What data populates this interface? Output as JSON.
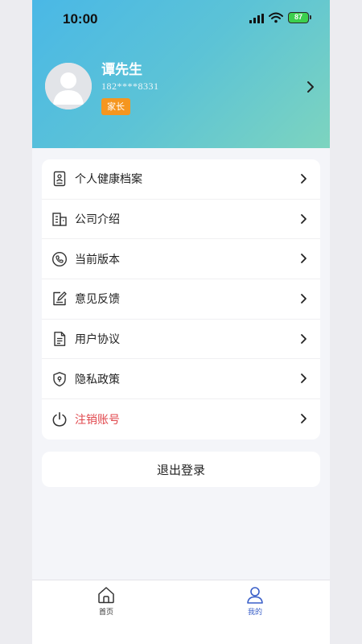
{
  "status_bar": {
    "time": "10:00",
    "battery": "87"
  },
  "profile": {
    "name": "谭先生",
    "phone": "182****8331",
    "role": "家长"
  },
  "menu": {
    "items": [
      {
        "label": "个人健康档案",
        "icon": "health-record-icon"
      },
      {
        "label": "公司介绍",
        "icon": "building-icon"
      },
      {
        "label": "当前版本",
        "icon": "phone-icon"
      },
      {
        "label": "意见反馈",
        "icon": "feedback-edit-icon"
      },
      {
        "label": "用户协议",
        "icon": "document-icon"
      },
      {
        "label": "隐私政策",
        "icon": "shield-icon"
      },
      {
        "label": "注销账号",
        "icon": "power-icon"
      }
    ]
  },
  "logout_label": "退出登录",
  "tabbar": {
    "home_label": "首页",
    "mine_label": "我的"
  },
  "colors": {
    "header_gradient_start": "#4ab8e6",
    "header_gradient_end": "#7dd4bf",
    "badge": "#f5961f",
    "danger": "#e0474c",
    "tab_active": "#3a5fc8"
  }
}
